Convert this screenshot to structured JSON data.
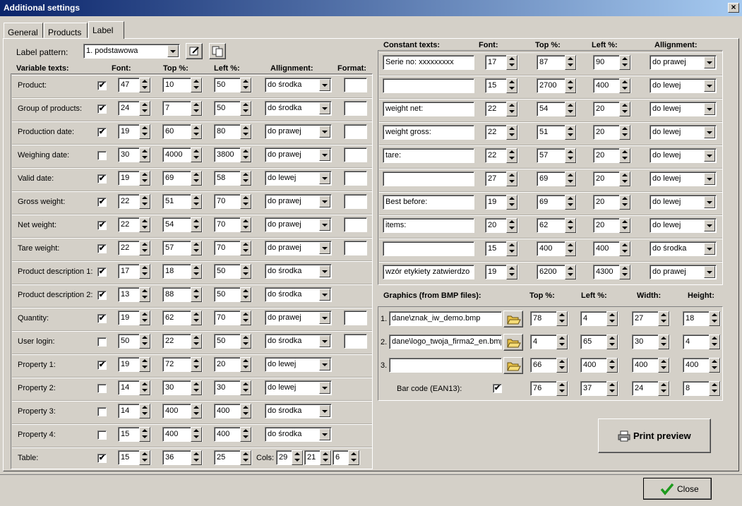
{
  "window": {
    "title": "Additional settings"
  },
  "tabs": [
    "General",
    "Products",
    "Label"
  ],
  "label_pattern": {
    "label": "Label pattern:",
    "value": "1. podstawowa"
  },
  "variable": {
    "headers": {
      "name": "Variable texts:",
      "font": "Font:",
      "top": "Top %:",
      "left": "Left %:",
      "align": "Allignment:",
      "format": "Format:"
    },
    "rows": [
      {
        "name": "Product:",
        "checked": true,
        "font": "47",
        "top": "10",
        "left": "50",
        "align": "do środka",
        "format": ""
      },
      {
        "name": "Group of products:",
        "checked": true,
        "font": "24",
        "top": "7",
        "left": "50",
        "align": "do środka",
        "format": ""
      },
      {
        "name": "Production date:",
        "checked": true,
        "font": "19",
        "top": "60",
        "left": "80",
        "align": "do prawej",
        "format": ""
      },
      {
        "name": "Weighing date:",
        "checked": false,
        "font": "30",
        "top": "4000",
        "left": "3800",
        "align": "do prawej",
        "format": ""
      },
      {
        "name": "Valid date:",
        "checked": true,
        "font": "19",
        "top": "69",
        "left": "58",
        "align": "do lewej",
        "format": ""
      },
      {
        "name": "Gross weight:",
        "checked": true,
        "font": "22",
        "top": "51",
        "left": "70",
        "align": "do prawej",
        "format": ""
      },
      {
        "name": "Net weight:",
        "checked": true,
        "font": "22",
        "top": "54",
        "left": "70",
        "align": "do prawej",
        "format": ""
      },
      {
        "name": "Tare weight:",
        "checked": true,
        "font": "22",
        "top": "57",
        "left": "70",
        "align": "do prawej",
        "format": ""
      },
      {
        "name": "Product description 1:",
        "checked": true,
        "font": "17",
        "top": "18",
        "left": "50",
        "align": "do środka",
        "format": null
      },
      {
        "name": "Product description 2:",
        "checked": true,
        "font": "13",
        "top": "88",
        "left": "50",
        "align": "do środka",
        "format": null
      },
      {
        "name": "Quantity:",
        "checked": true,
        "font": "19",
        "top": "62",
        "left": "70",
        "align": "do prawej",
        "format": ""
      },
      {
        "name": "User login:",
        "checked": false,
        "font": "50",
        "top": "22",
        "left": "50",
        "align": "do środka",
        "format": ""
      },
      {
        "name": "Property 1:",
        "checked": true,
        "font": "19",
        "top": "72",
        "left": "20",
        "align": "do lewej",
        "format": null
      },
      {
        "name": "Property 2:",
        "checked": false,
        "font": "14",
        "top": "30",
        "left": "30",
        "align": "do lewej",
        "format": null
      },
      {
        "name": "Property 3:",
        "checked": false,
        "font": "14",
        "top": "400",
        "left": "400",
        "align": "do środka",
        "format": null
      },
      {
        "name": "Property 4:",
        "checked": false,
        "font": "15",
        "top": "400",
        "left": "400",
        "align": "do środka",
        "format": null
      }
    ],
    "table": {
      "name": "Table:",
      "checked": true,
      "font": "15",
      "top": "36",
      "left": "25",
      "cols_label": "Cols:",
      "cols": [
        "29",
        "21",
        "6"
      ]
    }
  },
  "constant": {
    "headers": {
      "name": "Constant texts:",
      "font": "Font:",
      "top": "Top %:",
      "left": "Left %:",
      "align": "Allignment:"
    },
    "rows": [
      {
        "text": "Serie no: xxxxxxxxx",
        "font": "17",
        "top": "87",
        "left": "90",
        "align": "do prawej"
      },
      {
        "text": "",
        "font": "15",
        "top": "2700",
        "left": "400",
        "align": "do lewej"
      },
      {
        "text": "weight net:",
        "font": "22",
        "top": "54",
        "left": "20",
        "align": "do lewej"
      },
      {
        "text": "weight gross:",
        "font": "22",
        "top": "51",
        "left": "20",
        "align": "do lewej"
      },
      {
        "text": "tare:",
        "font": "22",
        "top": "57",
        "left": "20",
        "align": "do lewej"
      },
      {
        "text": "",
        "font": "27",
        "top": "69",
        "left": "20",
        "align": "do lewej"
      },
      {
        "text": "Best before:",
        "font": "19",
        "top": "69",
        "left": "20",
        "align": "do lewej"
      },
      {
        "text": "items:",
        "font": "20",
        "top": "62",
        "left": "20",
        "align": "do lewej"
      },
      {
        "text": "",
        "font": "15",
        "top": "400",
        "left": "400",
        "align": "do środka"
      },
      {
        "text": "wzór etykiety zatwierdzo",
        "font": "19",
        "top": "6200",
        "left": "4300",
        "align": "do prawej"
      }
    ]
  },
  "graphics": {
    "headers": {
      "name": "Graphics (from BMP files):",
      "top": "Top %:",
      "left": "Left %:",
      "width": "Width:",
      "height": "Height:"
    },
    "rows": [
      {
        "num": "1.",
        "file": "dane\\znak_iw_demo.bmp",
        "top": "78",
        "left": "4",
        "width": "27",
        "height": "18"
      },
      {
        "num": "2.",
        "file": "dane\\logo_twoja_firma2_en.bmp",
        "top": "4",
        "left": "65",
        "width": "30",
        "height": "4"
      },
      {
        "num": "3.",
        "file": "",
        "top": "66",
        "left": "400",
        "width": "400",
        "height": "400"
      }
    ],
    "barcode": {
      "label": "Bar code (EAN13):",
      "checked": true,
      "top": "76",
      "left": "37",
      "width": "24",
      "height": "8"
    }
  },
  "buttons": {
    "print_preview": "Print preview",
    "close": "Close"
  },
  "icons": {
    "close": "close-icon",
    "printer": "printer-icon",
    "checkmark": "checkmark-icon",
    "folder": "folder-open-icon",
    "edit": "edit-icon",
    "copy": "copy-icon"
  }
}
